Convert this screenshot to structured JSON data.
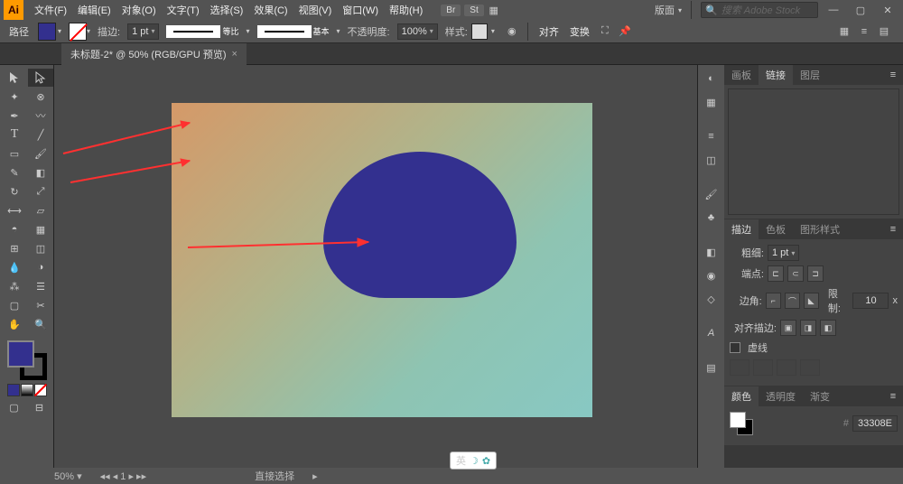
{
  "app": {
    "icon": "Ai"
  },
  "menu": [
    "文件(F)",
    "编辑(E)",
    "对象(O)",
    "文字(T)",
    "选择(S)",
    "效果(C)",
    "视图(V)",
    "窗口(W)",
    "帮助(H)"
  ],
  "top_right": {
    "pills": [
      "Br",
      "St"
    ],
    "layout_label": "版面",
    "search_placeholder": "搜索 Adobe Stock"
  },
  "sub_bar": {
    "left_label": "路径",
    "stroke_label": "描边:",
    "stroke_value": "1 pt",
    "var_profile_label": "等比",
    "brush_label": "基本",
    "opacity_label": "不透明度:",
    "opacity_value": "100%",
    "style_label": "样式:",
    "align_label": "对齐",
    "transform_label": "变换"
  },
  "doc_tab": {
    "title": "未标题-2* @ 50% (RGB/GPU 预览)"
  },
  "tools": [
    "select",
    "direct",
    "wand",
    "lasso",
    "pen",
    "curvature",
    "type",
    "line",
    "rect",
    "brush",
    "pencil",
    "eraser",
    "rotate",
    "scale",
    "width",
    "free",
    "shape-builder",
    "perspective",
    "mesh",
    "gradient",
    "eyedrop",
    "blend",
    "symbol",
    "column",
    "artboard",
    "slice",
    "hand",
    "zoom"
  ],
  "fill_color": "#33308e",
  "panels_top": {
    "tabs": [
      "画板",
      "链接",
      "图层"
    ],
    "active": 1
  },
  "stroke_panel": {
    "tabs": [
      "描边",
      "色板",
      "图形样式"
    ],
    "active": 0,
    "weight_label": "粗细:",
    "weight_value": "1 pt",
    "cap_label": "端点:",
    "corner_label": "边角:",
    "limit_label": "限制:",
    "limit_value": "10",
    "limit_unit": "x",
    "align_label": "对齐描边:",
    "dashed_label": "虚线"
  },
  "color_panel": {
    "tabs": [
      "颜色",
      "透明度",
      "渐变"
    ],
    "active": 0,
    "hex_value": "33308E"
  },
  "status": {
    "zoom": "50%",
    "artboard": "1",
    "tool": "直接选择"
  },
  "float": {
    "lang": "英",
    "moon": "☽",
    "gear": "✿"
  }
}
